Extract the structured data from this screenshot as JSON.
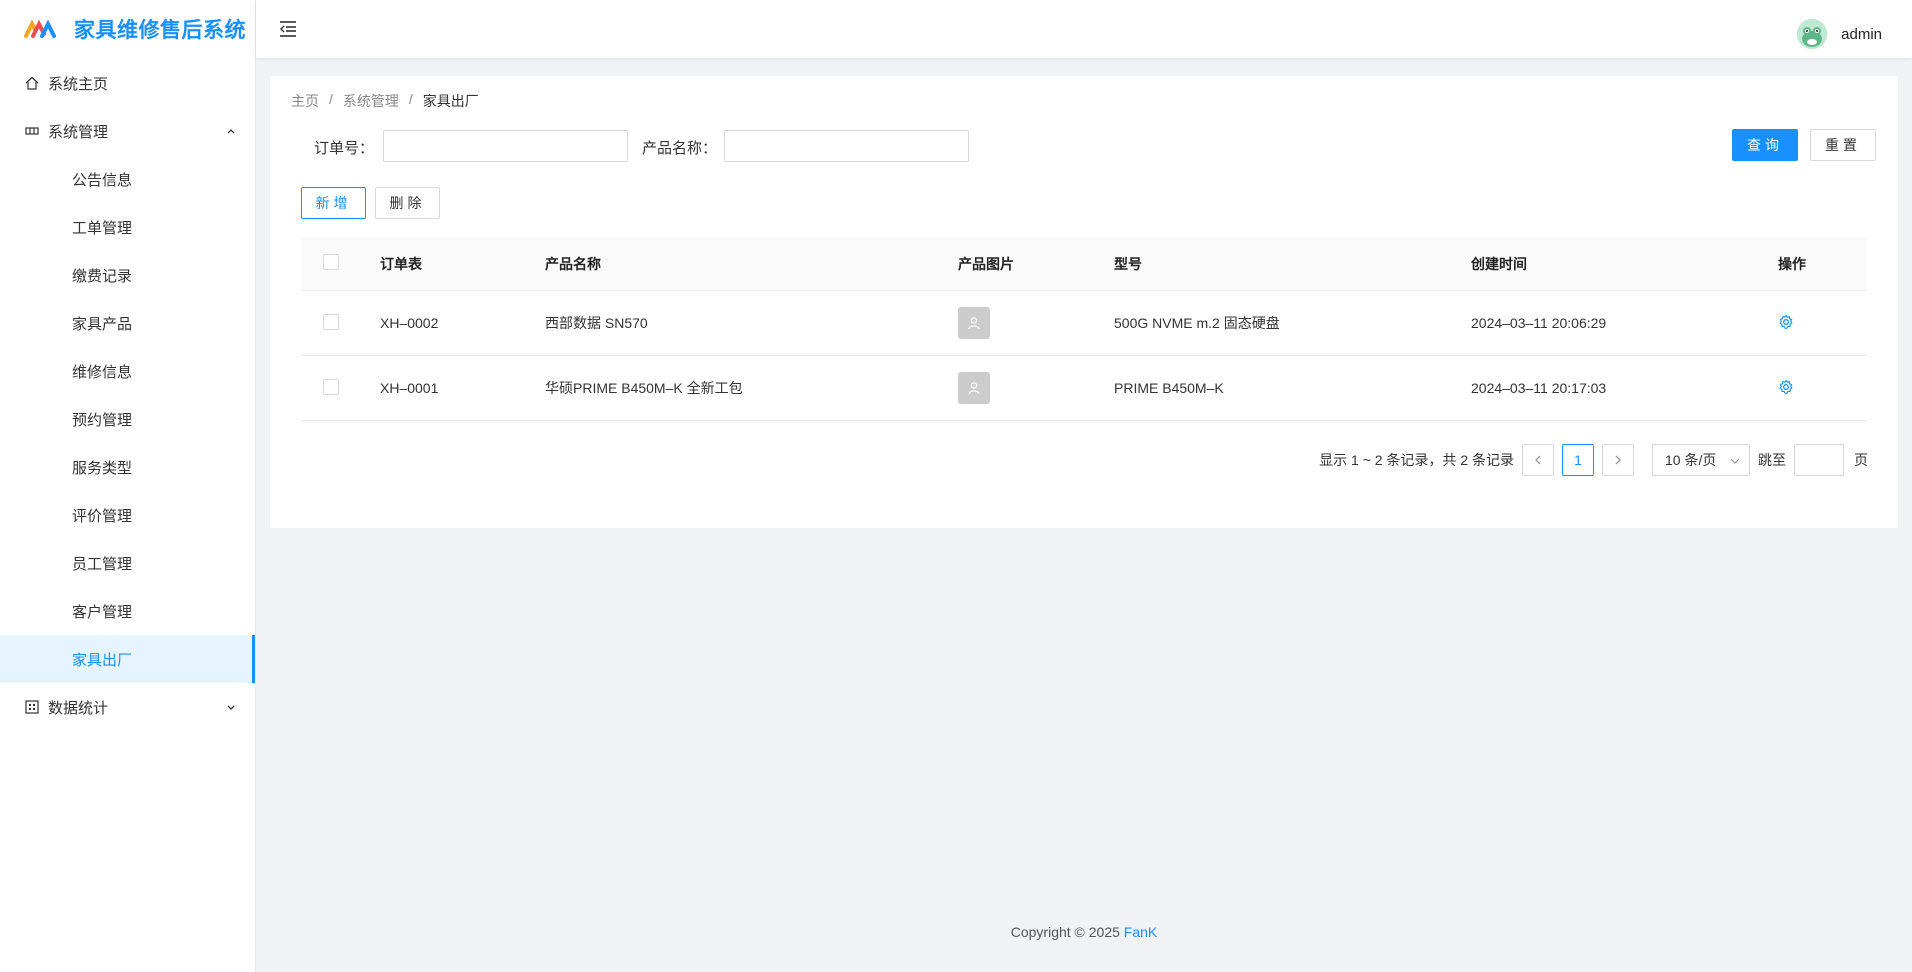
{
  "app": {
    "title": "家具维修售后系统"
  },
  "sidebar": {
    "home": "系统主页",
    "system": "系统管理",
    "system_items": [
      "公告信息",
      "工单管理",
      "缴费记录",
      "家具产品",
      "维修信息",
      "预约管理",
      "服务类型",
      "评价管理",
      "员工管理",
      "客户管理",
      "家具出厂"
    ],
    "active_item": "家具出厂",
    "stats": "数据统计"
  },
  "header": {
    "username": "admin"
  },
  "breadcrumb": [
    "主页",
    "系统管理",
    "家具出厂"
  ],
  "search": {
    "order_label": "订单号：",
    "order_value": "",
    "product_label": "产品名称：",
    "product_value": "",
    "query_btn": "查询",
    "reset_btn": "重置"
  },
  "actions": {
    "add": "新增",
    "delete": "删除"
  },
  "table": {
    "headers": [
      "订单表",
      "产品名称",
      "产品图片",
      "型号",
      "创建时间",
      "操作"
    ],
    "rows": [
      {
        "order": "XH–0002",
        "name": "西部数据 SN570",
        "model": "500G NVME m.2 固态硬盘",
        "time": "2024–03–11 20:06:29"
      },
      {
        "order": "XH–0001",
        "name": "华硕PRIME B450M–K 全新工包",
        "model": "PRIME B450M–K",
        "time": "2024–03–11 20:17:03"
      }
    ]
  },
  "pagination": {
    "summary": "显示 1 ~ 2 条记录，共 2 条记录",
    "current": "1",
    "page_size": "10 条/页",
    "jump_label": "跳至",
    "page_suffix": "页"
  },
  "footer": {
    "copyright": "Copyright © 2025",
    "author": "FanK"
  },
  "colors": {
    "primary": "#1890ff",
    "bg": "#f0f2f5"
  }
}
